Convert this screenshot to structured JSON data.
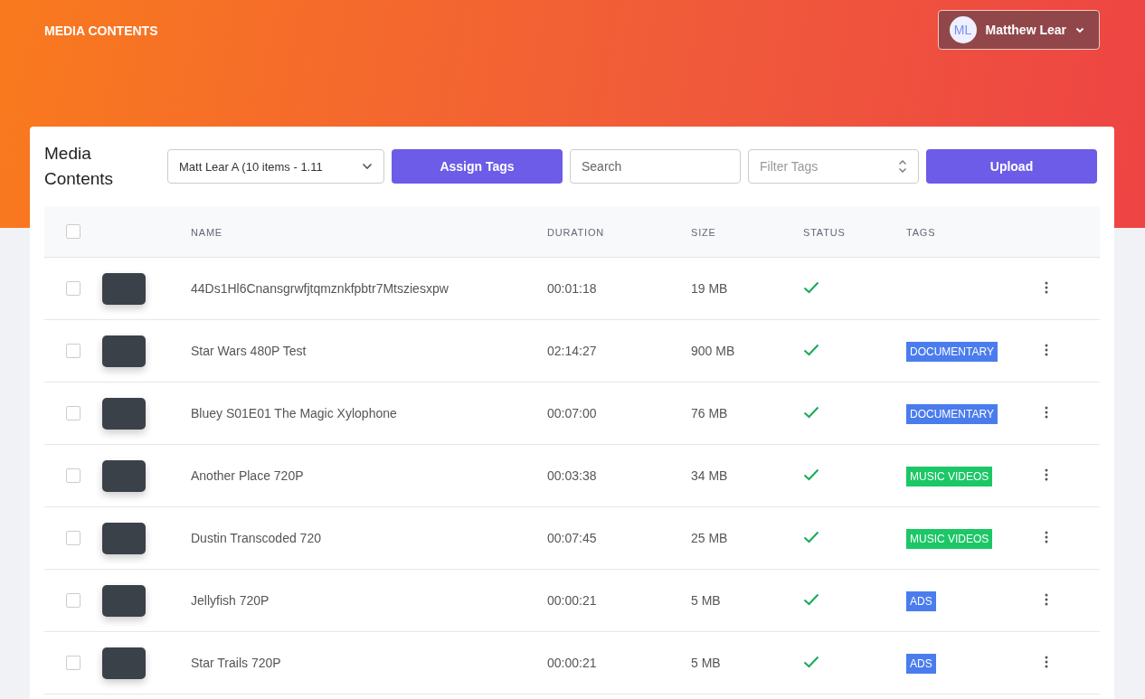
{
  "header": {
    "title": "MEDIA CONTENTS",
    "user": {
      "initials": "ML",
      "name": "Matthew Lear"
    }
  },
  "panel": {
    "title": "Media Contents",
    "library_select": {
      "value": "Matt Lear A (10 items - 1.11"
    },
    "assign_button": "Assign Tags",
    "search": {
      "placeholder": "Search"
    },
    "filter": {
      "placeholder": "Filter Tags"
    },
    "upload_button": "Upload"
  },
  "table": {
    "select_all": {
      "checked": false
    },
    "columns": [
      "NAME",
      "DURATION",
      "SIZE",
      "STATUS",
      "TAGS"
    ],
    "rows": [
      {
        "checked": false,
        "name": "44Ds1Hl6Cnansgrwfjtqmznkfpbtr7Mtsziesxpw",
        "duration": "00:01:18",
        "size": "19 MB",
        "complete": true,
        "tags": []
      },
      {
        "checked": false,
        "name": "Star Wars 480P Test",
        "duration": "02:14:27",
        "size": "900 MB",
        "complete": true,
        "tags": [
          {
            "label": "DOCUMENTARY",
            "color": "#4a7ced"
          }
        ]
      },
      {
        "checked": false,
        "name": "Bluey S01E01 The Magic Xylophone",
        "duration": "00:07:00",
        "size": "76 MB",
        "complete": true,
        "tags": [
          {
            "label": "DOCUMENTARY",
            "color": "#4a7ced"
          }
        ]
      },
      {
        "checked": false,
        "name": "Another Place 720P",
        "duration": "00:03:38",
        "size": "34 MB",
        "complete": true,
        "tags": [
          {
            "label": "MUSIC VIDEOS",
            "color": "#1cc766"
          }
        ]
      },
      {
        "checked": false,
        "name": "Dustin Transcoded 720",
        "duration": "00:07:45",
        "size": "25 MB",
        "complete": true,
        "tags": [
          {
            "label": "MUSIC VIDEOS",
            "color": "#1cc766"
          }
        ]
      },
      {
        "checked": false,
        "name": "Jellyfish 720P",
        "duration": "00:00:21",
        "size": "5 MB",
        "complete": true,
        "tags": [
          {
            "label": "ADS",
            "color": "#4a7ced"
          }
        ]
      },
      {
        "checked": false,
        "name": "Star Trails 720P",
        "duration": "00:00:21",
        "size": "5 MB",
        "complete": true,
        "tags": [
          {
            "label": "ADS",
            "color": "#4a7ced"
          }
        ]
      }
    ]
  }
}
